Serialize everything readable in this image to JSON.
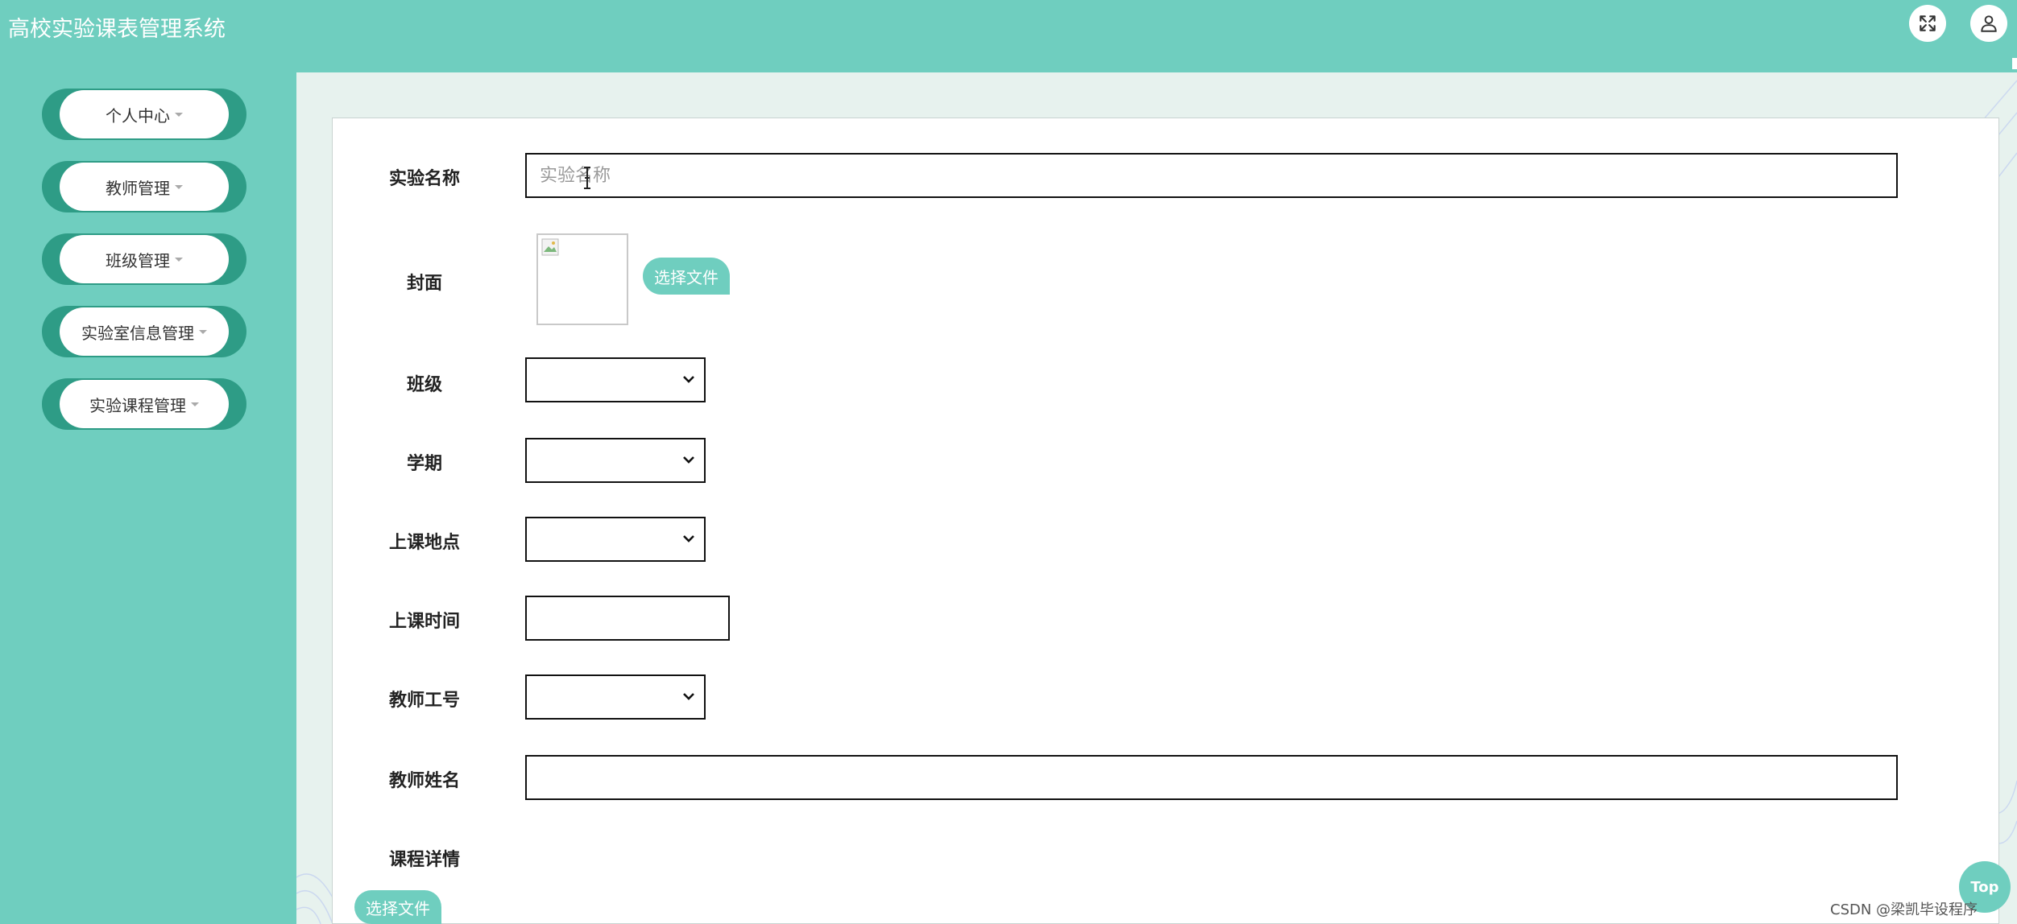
{
  "header": {
    "app_title": "高校实验课表管理系统",
    "fullscreen_icon": "expand-arrows-icon",
    "user_icon": "user-icon"
  },
  "sidebar": {
    "items": [
      {
        "label": "个人中心"
      },
      {
        "label": "教师管理"
      },
      {
        "label": "班级管理"
      },
      {
        "label": "实验室信息管理"
      },
      {
        "label": "实验课程管理"
      }
    ]
  },
  "form": {
    "experiment_name": {
      "label": "实验名称",
      "value": "",
      "placeholder": "实验名称"
    },
    "cover": {
      "label": "封面",
      "button": "选择文件"
    },
    "class": {
      "label": "班级",
      "value": ""
    },
    "term": {
      "label": "学期",
      "value": ""
    },
    "location": {
      "label": "上课地点",
      "value": ""
    },
    "time": {
      "label": "上课时间",
      "value": ""
    },
    "teacher_id": {
      "label": "教师工号",
      "value": ""
    },
    "teacher_name": {
      "label": "教师姓名",
      "value": ""
    },
    "course_detail": {
      "label": "课程详情",
      "button": "选择文件"
    }
  },
  "top_button": "Top",
  "watermark": "CSDN @梁凯毕设程序",
  "colors": {
    "primary": "#6fcebf",
    "menu_shadow": "#2e9c86",
    "content_bg": "#e7f2ee"
  }
}
